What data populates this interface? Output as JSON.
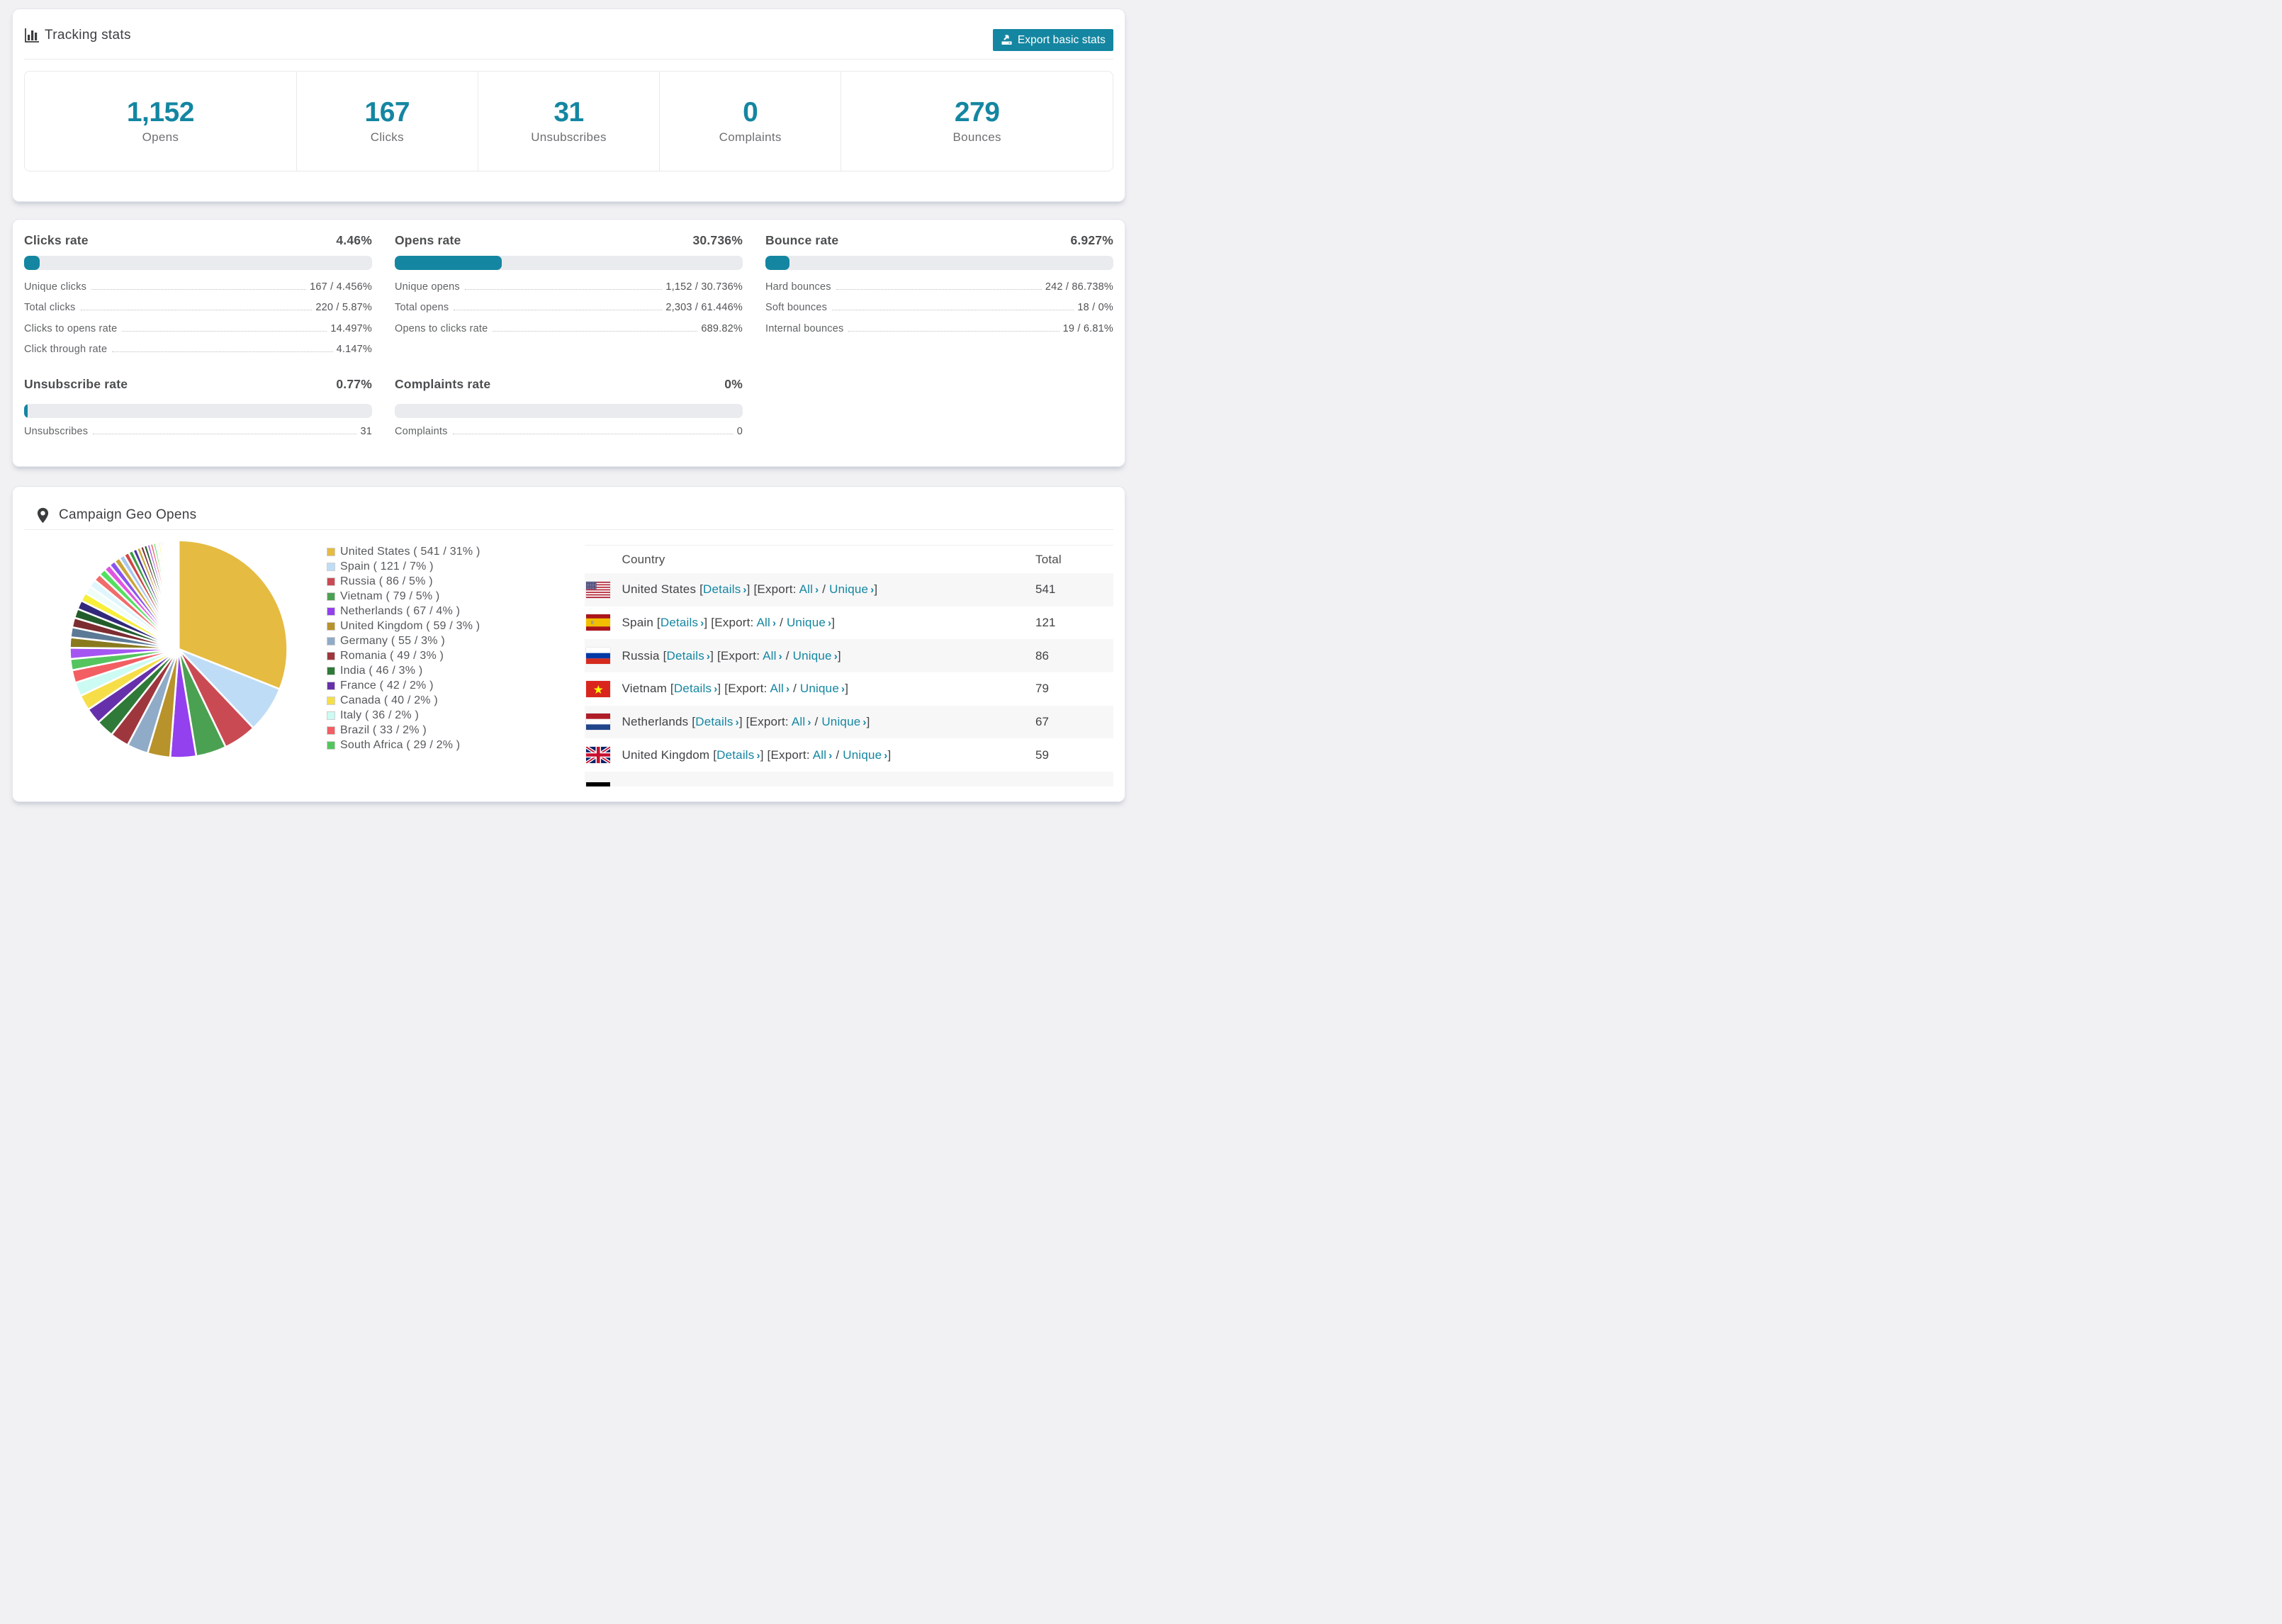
{
  "accent_color": "#1486a1",
  "tracking": {
    "title": "Tracking stats",
    "icon": "bar-chart-icon",
    "export_button": "Export basic stats",
    "summary": [
      {
        "value": "1,152",
        "label": "Opens"
      },
      {
        "value": "167",
        "label": "Clicks"
      },
      {
        "value": "31",
        "label": "Unsubscribes"
      },
      {
        "value": "0",
        "label": "Complaints"
      },
      {
        "value": "279",
        "label": "Bounces"
      }
    ]
  },
  "rates": {
    "blocks": [
      {
        "title": "Clicks rate",
        "percent": "4.46%",
        "bar_percent": 4.46,
        "rows": [
          [
            "Unique clicks",
            "167 / 4.456%"
          ],
          [
            "Total clicks",
            "220 / 5.87%"
          ],
          [
            "Clicks to opens rate",
            "14.497%"
          ],
          [
            "Click through rate",
            "4.147%"
          ]
        ]
      },
      {
        "title": "Opens rate",
        "percent": "30.736%",
        "bar_percent": 30.736,
        "rows": [
          [
            "Unique opens",
            "1,152 / 30.736%"
          ],
          [
            "Total opens",
            "2,303 / 61.446%"
          ],
          [
            "Opens to clicks rate",
            "689.82%"
          ]
        ]
      },
      {
        "title": "Bounce rate",
        "percent": "6.927%",
        "bar_percent": 6.927,
        "rows": [
          [
            "Hard bounces",
            "242 / 86.738%"
          ],
          [
            "Soft bounces",
            "18 / 0%"
          ],
          [
            "Internal bounces",
            "19 / 6.81%"
          ]
        ]
      },
      {
        "title": "Unsubscribe rate",
        "percent": "0.77%",
        "bar_percent": 0.77,
        "rows": [
          [
            "Unsubscribes",
            "31"
          ]
        ]
      },
      {
        "title": "Complaints rate",
        "percent": "0%",
        "bar_percent": 0,
        "rows": [
          [
            "Complaints",
            "0"
          ]
        ]
      }
    ]
  },
  "geo": {
    "title": "Campaign Geo Opens",
    "icon": "map-marker-icon",
    "chart_data": {
      "type": "pie",
      "legend_position": "right",
      "series": [
        {
          "name": "United States",
          "value": 541,
          "label": "United States ( 541 / 31% )",
          "color": "#e5bb41"
        },
        {
          "name": "Spain",
          "value": 121,
          "label": "Spain ( 121 / 7% )",
          "color": "#bedcf6"
        },
        {
          "name": "Russia",
          "value": 86,
          "label": "Russia ( 86 / 5% )",
          "color": "#ca4a53"
        },
        {
          "name": "Vietnam",
          "value": 79,
          "label": "Vietnam ( 79 / 5% )",
          "color": "#4ba152"
        },
        {
          "name": "Netherlands",
          "value": 67,
          "label": "Netherlands ( 67 / 4% )",
          "color": "#9340ee"
        },
        {
          "name": "United Kingdom",
          "value": 59,
          "label": "United Kingdom ( 59 / 3% )",
          "color": "#b8922a"
        },
        {
          "name": "Germany",
          "value": 55,
          "label": "Germany ( 55 / 3% )",
          "color": "#8fabc7"
        },
        {
          "name": "Romania",
          "value": 49,
          "label": "Romania ( 49 / 3% )",
          "color": "#9e373d"
        },
        {
          "name": "India",
          "value": 46,
          "label": "India ( 46 / 3% )",
          "color": "#2f7a38"
        },
        {
          "name": "France",
          "value": 42,
          "label": "France ( 42 / 2% )",
          "color": "#6630ab"
        },
        {
          "name": "Canada",
          "value": 40,
          "label": "Canada ( 40 / 2% )",
          "color": "#f6de49"
        },
        {
          "name": "Italy",
          "value": 36,
          "label": "Italy ( 36 / 2% )",
          "color": "#ccfbf3"
        },
        {
          "name": "Brazil",
          "value": 33,
          "label": "Brazil ( 33 / 2% )",
          "color": "#f25e62"
        },
        {
          "name": "South Africa",
          "value": 29,
          "label": "South Africa ( 29 / 2% )",
          "color": "#54c55e"
        }
      ],
      "others_values": [
        29,
        27,
        26,
        25,
        24,
        23,
        22,
        21,
        20,
        19,
        18,
        17,
        16,
        15,
        14,
        13,
        12,
        11,
        10,
        9,
        9,
        8,
        8,
        7,
        6,
        6,
        5,
        5,
        4,
        4,
        3,
        3,
        2,
        2,
        2,
        2,
        2,
        2,
        1,
        1,
        1,
        1,
        1,
        1,
        1,
        1,
        1,
        1,
        1
      ],
      "others_colors": [
        "#a556f2",
        "#8a7a1e",
        "#5c7a96",
        "#7c2d31",
        "#235c2b",
        "#32297a",
        "#f7ef3a",
        "#effdf9",
        "#dff6fd",
        "#f26a6a",
        "#53e05e",
        "#e055e0",
        "#8a55f0",
        "#c9a53a",
        "#a8c8f0",
        "#d04545",
        "#3a9e42",
        "#4a3a9e",
        "#c9a53a",
        "#7c2d31",
        "#235c2b",
        "#a556f2",
        "#f26a6a",
        "#53e05e",
        "#e9e9e9",
        "#f7ef3a",
        "#32297a",
        "#8a7a1e",
        "#5c7a96",
        "#d04545",
        "#effdf9",
        "#a8c8f0",
        "#e055e0",
        "#3a9e42",
        "#8a55f0",
        "#c9a53a",
        "#7c2d31",
        "#f26a6a",
        "#a556f2",
        "#53e05e",
        "#f7ef3a",
        "#4a3a9e",
        "#d04545",
        "#235c2b",
        "#e055e0",
        "#a8c8f0",
        "#8a7a1e",
        "#f26a6a",
        "#5c7a96"
      ]
    },
    "table": {
      "headers": {
        "country": "Country",
        "total": "Total"
      },
      "link_labels": {
        "details": "Details",
        "export": "Export:",
        "all": "All",
        "unique": "Unique"
      },
      "rows": [
        {
          "country": "United States",
          "flag": "us",
          "total": "541"
        },
        {
          "country": "Spain",
          "flag": "es",
          "total": "121"
        },
        {
          "country": "Russia",
          "flag": "ru",
          "total": "86"
        },
        {
          "country": "Vietnam",
          "flag": "vn",
          "total": "79"
        },
        {
          "country": "Netherlands",
          "flag": "nl",
          "total": "67"
        },
        {
          "country": "United Kingdom",
          "flag": "gb",
          "total": "59"
        }
      ],
      "partial_row": {
        "flag": "de"
      }
    }
  }
}
